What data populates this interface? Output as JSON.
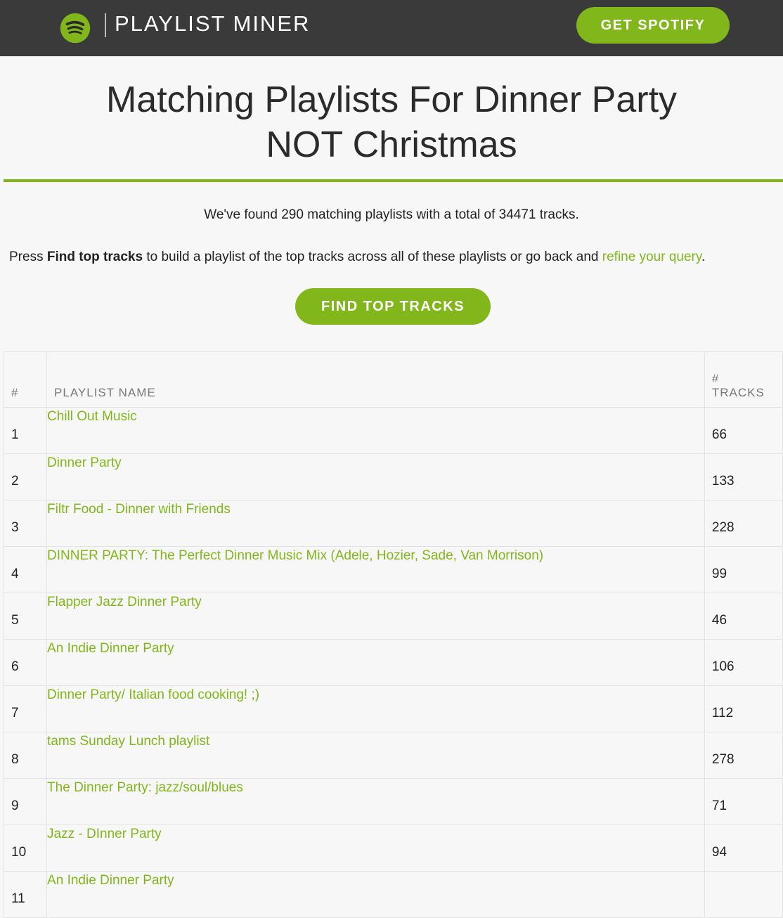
{
  "header": {
    "logo_icon": "spotify-logo-icon",
    "brand": "PLAYLIST MINER",
    "cta_label": "GET SPOTIFY"
  },
  "colors": {
    "accent": "#81b71a",
    "topbar": "#3a3a3a",
    "background": "#f7f7f7"
  },
  "title": "Matching Playlists For Dinner Party NOT Christmas",
  "summary": "We've found 290 matching playlists with a total of 34471 tracks.",
  "instructions": {
    "prefix": "Press ",
    "bold": "Find top tracks",
    "middle": " to build a playlist of the top tracks across all of these playlists or go back and ",
    "link": "refine your query",
    "suffix": "."
  },
  "find_button_label": "FIND TOP TRACKS",
  "table": {
    "headers": {
      "num": "#",
      "name": "PLAYLIST NAME",
      "tracks_line1": "#",
      "tracks_line2": "TRACKS"
    },
    "rows": [
      {
        "num": "1",
        "name": "Chill Out Music",
        "tracks": "66"
      },
      {
        "num": "2",
        "name": "Dinner Party",
        "tracks": "133"
      },
      {
        "num": "3",
        "name": "Filtr Food - Dinner with Friends",
        "tracks": "228"
      },
      {
        "num": "4",
        "name": "DINNER PARTY: The Perfect Dinner Music Mix (Adele, Hozier, Sade, Van Morrison)",
        "tracks": "99"
      },
      {
        "num": "5",
        "name": "Flapper Jazz Dinner Party",
        "tracks": "46"
      },
      {
        "num": "6",
        "name": "An Indie Dinner Party",
        "tracks": "106"
      },
      {
        "num": "7",
        "name": "Dinner Party/ Italian food cooking! ;)",
        "tracks": "112"
      },
      {
        "num": "8",
        "name": "tams Sunday Lunch playlist",
        "tracks": "278"
      },
      {
        "num": "9",
        "name": "The Dinner Party: jazz/soul/blues",
        "tracks": "71"
      },
      {
        "num": "10",
        "name": "Jazz - DInner Party",
        "tracks": "94"
      },
      {
        "num": "11",
        "name": "An Indie Dinner Party",
        "tracks": ""
      }
    ]
  }
}
